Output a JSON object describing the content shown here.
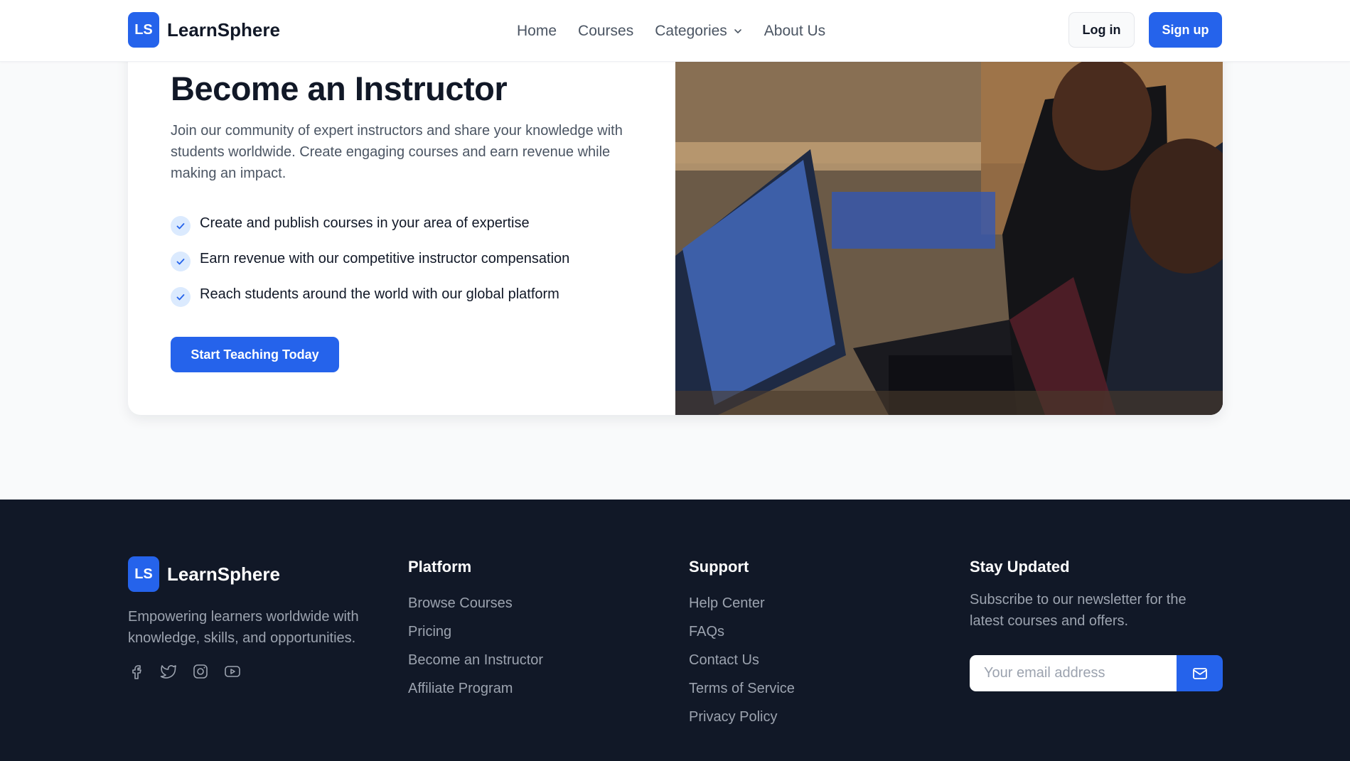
{
  "header": {
    "logo_initials": "LS",
    "brand": "LearnSphere",
    "nav": [
      "Home",
      "Courses",
      "Categories",
      "About Us"
    ],
    "login_label": "Log in",
    "signup_label": "Sign up"
  },
  "instructor": {
    "title": "Become an Instructor",
    "description": "Join our community of expert instructors and share your knowledge with students worldwide. Create engaging courses and earn revenue while making an impact.",
    "features": [
      "Create and publish courses in your area of expertise",
      "Earn revenue with our competitive instructor compensation",
      "Reach students around the world with our global platform"
    ],
    "cta_label": "Start Teaching Today"
  },
  "footer": {
    "logo_initials": "LS",
    "brand": "LearnSphere",
    "tagline": "Empowering learners worldwide with knowledge, skills, and opportunities.",
    "socials": [
      "facebook-icon",
      "twitter-icon",
      "instagram-icon",
      "youtube-icon"
    ],
    "platform": {
      "heading": "Platform",
      "links": [
        "Browse Courses",
        "Pricing",
        "Become an Instructor",
        "Affiliate Program"
      ]
    },
    "support": {
      "heading": "Support",
      "links": [
        "Help Center",
        "FAQs",
        "Contact Us",
        "Terms of Service",
        "Privacy Policy"
      ]
    },
    "newsletter": {
      "heading": "Stay Updated",
      "text": "Subscribe to our newsletter for the latest courses and offers.",
      "placeholder": "Your email address",
      "value": ""
    }
  },
  "colors": {
    "primary": "#2563eb",
    "footer_bg": "#111827",
    "page_bg": "#f9fafb"
  }
}
